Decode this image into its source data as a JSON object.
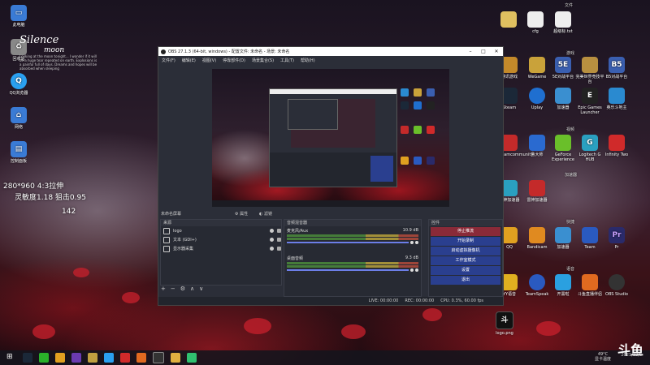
{
  "desktop": {
    "left_icons": [
      {
        "label": "此电脑",
        "color": "#3a7bd5"
      },
      {
        "label": "回收站",
        "color": "#888888"
      },
      {
        "label": "QQ浏览器",
        "color": "#2aa0f0"
      },
      {
        "label": "网络",
        "color": "#3a7bd5"
      },
      {
        "label": "控制面板",
        "color": "#3a7bd5"
      }
    ],
    "logo": {
      "line1": "Silence",
      "line2": "moon",
      "small": "Looking at the moon tonight... I wonder if it will be a huge tear repeated on earth. Explosions is a painful full of days. Dreams and hopes will be absorbed when sleeping"
    },
    "overlay_lines": [
      "280*960 4:3拉伸",
      "灵敏度1.18 狙击0.95"
    ],
    "overlay_fragment": "142",
    "right_group_top": "文件",
    "right_top_items": [
      "cfg",
      "超级标.txt"
    ],
    "group_games": "游戏",
    "game_icons": [
      {
        "label": "腾讯游戏",
        "color": "#c48a2a"
      },
      {
        "label": "WeGame",
        "color": "#c9a23a"
      },
      {
        "label": "5E对战平台",
        "color": "#3a5fb0"
      },
      {
        "label": "完美世界竞技平台",
        "color": "#b89040"
      },
      {
        "label": "B5对战平台",
        "color": "#3a5fb0"
      },
      {
        "label": "Steam",
        "color": "#1b2838"
      },
      {
        "label": "Uplay",
        "color": "#1f6fd0"
      },
      {
        "label": "加速器",
        "color": "#3a8fd0"
      },
      {
        "label": "Epic Games Launcher",
        "color": "#222222"
      },
      {
        "label": "英乐斗地主",
        "color": "#2a8ad0"
      }
    ],
    "group_media": "视频",
    "media_icons": [
      {
        "label": "Streamcommunity",
        "color": "#c42a2a"
      },
      {
        "label": "鲁大师",
        "color": "#2a6ad0"
      },
      {
        "label": "GeForce Experience",
        "color": "#6abf2a"
      },
      {
        "label": "Logitech G HUB",
        "color": "#2aa0c0"
      },
      {
        "label": "Infinity Two",
        "color": "#d02a2a"
      }
    ],
    "group_tools": "加速器",
    "tool_icons": [
      {
        "label": "雷神加速器",
        "color": "#2aa0c0"
      },
      {
        "label": "雷神加速器",
        "color": "#c42a2a"
      }
    ],
    "group_apps": "快捷",
    "app_icons": [
      {
        "label": "QQ",
        "color": "#e0a020"
      },
      {
        "label": "Bandicam",
        "color": "#e08a20"
      },
      {
        "label": "加速器",
        "color": "#3a8fd0"
      },
      {
        "label": "Team",
        "color": "#2a5ac0"
      },
      {
        "label": "Pr",
        "color": "#2a2a6a"
      }
    ],
    "group_voice": "语音",
    "voice_icons": [
      {
        "label": "YY语音",
        "color": "#e0b020"
      },
      {
        "label": "TeamSpeak",
        "color": "#2a5ac0"
      },
      {
        "label": "开黑啦",
        "color": "#2aa0e0"
      },
      {
        "label": "斗鱼直播伴侣",
        "color": "#e06a20"
      },
      {
        "label": "OBS Studio",
        "color": "#333333"
      }
    ],
    "file_item": "logo.png",
    "watermark": "斗鱼"
  },
  "obs": {
    "title": "OBS 27.1.3 (64-bit, windows) - 配置文件: 未命名 - 场景: 未命名",
    "menu": [
      "文件(F)",
      "编辑(E)",
      "视图(V)",
      "停靠部件(D)",
      "场景集合(S)",
      "工具(T)",
      "帮助(H)"
    ],
    "dock_scene_header": "未命名屏幕",
    "props_label": "属性",
    "filters_label": "滤镜",
    "sources_header": "来源",
    "sources": [
      {
        "name": "logo"
      },
      {
        "name": "文本 (GDI+)"
      },
      {
        "name": "显示器采集"
      }
    ],
    "mixer_header": "音频混音器",
    "mixer": [
      {
        "name": "麦克风/Aux",
        "db": "10.9 dB"
      },
      {
        "name": "桌面音频",
        "db": "9.3 dB"
      }
    ],
    "controls_header": "控件",
    "controls": [
      "停止推流",
      "开始录制",
      "启动虚拟摄像机",
      "工作室模式",
      "设置",
      "退出"
    ],
    "toolbar": [
      "+",
      "−",
      "⚙",
      "∧",
      "∨"
    ],
    "status": {
      "live": "LIVE: 00:00:00",
      "rec": "REC: 00:00:00",
      "cpu": "CPU: 0.3%, 60.00 fps"
    }
  },
  "taskbar": {
    "apps": [
      {
        "name": "steam",
        "color": "#1b2838"
      },
      {
        "name": "wechat",
        "color": "#2ab02a"
      },
      {
        "name": "qq",
        "color": "#e0a020"
      },
      {
        "name": "game",
        "color": "#6a3ab0"
      },
      {
        "name": "cs",
        "color": "#c0a040"
      },
      {
        "name": "browser",
        "color": "#2aa0f0"
      },
      {
        "name": "netease",
        "color": "#d02a2a"
      },
      {
        "name": "douyu",
        "color": "#e06a20"
      },
      {
        "name": "obs",
        "color": "#333333"
      },
      {
        "name": "folder",
        "color": "#e0b040"
      },
      {
        "name": "qqmusic",
        "color": "#30c070"
      }
    ],
    "weather": "49°C",
    "weather_sub": "显卡温度",
    "date": "2021/12/6"
  },
  "colors": {
    "obs_bg": "#2b2e38",
    "control_blue": "#2a3f8f",
    "control_active": "#8a2a38"
  }
}
